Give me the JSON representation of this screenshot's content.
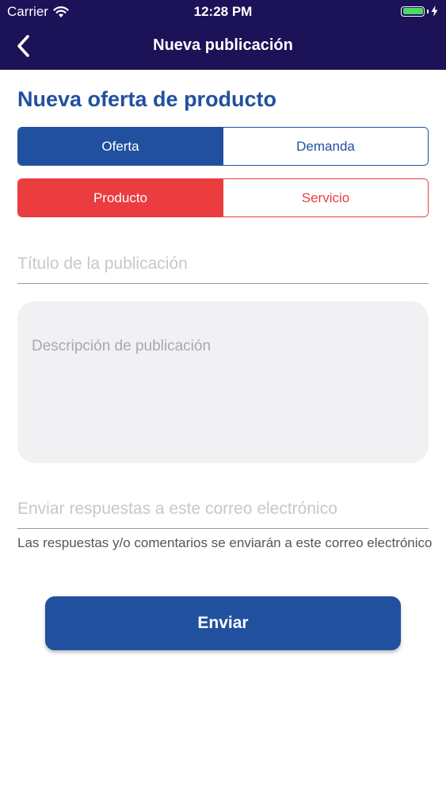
{
  "status_bar": {
    "carrier": "Carrier",
    "time": "12:28 PM",
    "battery_level": 1.0
  },
  "nav": {
    "title": "Nueva publicación",
    "back_icon": "chevron-left-icon"
  },
  "page": {
    "heading": "Nueva oferta de producto"
  },
  "type_selector": {
    "options": [
      "Oferta",
      "Demanda"
    ],
    "selected": "Oferta"
  },
  "category_selector": {
    "options": [
      "Producto",
      "Servicio"
    ],
    "selected": "Producto"
  },
  "form": {
    "title_placeholder": "Título de la publicación",
    "title_value": "",
    "description_placeholder": "Descripción de publicación",
    "description_value": "",
    "email_placeholder": "Enviar respuestas a este correo electrónico",
    "email_value": "",
    "email_helper": "Las respuestas y/o comentarios se enviarán a este correo electrónico"
  },
  "submit": {
    "label": "Enviar"
  },
  "colors": {
    "header_bg": "#1b1258",
    "primary": "#21509f",
    "danger": "#eb3c40",
    "battery": "#4cd964"
  }
}
